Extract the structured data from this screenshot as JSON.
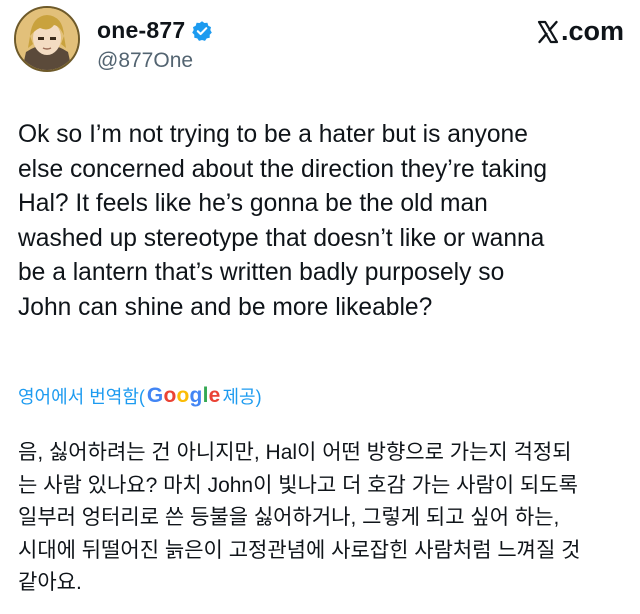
{
  "author": {
    "display_name": "one-877",
    "handle": "@877One",
    "verified_icon": "verified-badge-icon",
    "avatar_icon": "anime-character-avatar"
  },
  "brand": {
    "icon": "x-logo-icon",
    "suffix": ".com"
  },
  "tweet": {
    "text": "Ok so I’m not trying to be a hater but is anyone\nelse concerned about the direction they’re taking\nHal? It feels like he’s gonna be the old man\nwashed up stereotype that doesn’t like or wanna\nbe a lantern that’s written badly purposely so\nJohn can shine and be more likeable?"
  },
  "translation": {
    "label_prefix": "영어에서 번역함(",
    "provider_letters": [
      "G",
      "o",
      "o",
      "g",
      "l",
      "e"
    ],
    "label_suffix": " 제공)",
    "text": "음, 싫어하려는 건 아니지만, Hal이 어떤 방향으로 가는지 걱정되\n는 사람 있나요? 마치 John이 빛나고 더 호감 가는 사람이 되도록\n일부러 엉터리로 쓴 등불을 싫어하거나, 그렇게 되고 싶어 하는,\n시대에 뒤떨어진 늙은이 고정관념에 사로잡힌 사람처럼 느껴질 것\n같아요."
  },
  "colors": {
    "text": "#0f1419",
    "secondary": "#536471",
    "link": "#1d9bf0",
    "verified": "#1d9bf0"
  }
}
